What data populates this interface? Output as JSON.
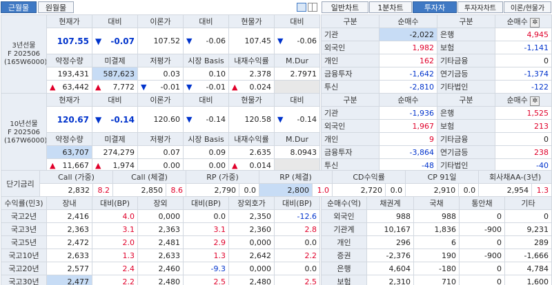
{
  "tabs_left": {
    "near": "근월물",
    "far": "원월물"
  },
  "tabs_right": [
    "일반차트",
    "1분차트",
    "투자자",
    "투자자차트",
    "이론/현물가"
  ],
  "futures": [
    {
      "label_lines": [
        "3년선물",
        "F 202506",
        "(165W6000)"
      ],
      "row1_headers": [
        "현재가",
        "대비",
        "이론가",
        "대비",
        "현물가",
        "대비"
      ],
      "price": "107.55",
      "price_change": "-0.07",
      "theory": "107.52",
      "theory_change": "-0.06",
      "spot": "107.45",
      "spot_change": "-0.06",
      "row2_headers": [
        "약정수량",
        "미결제",
        "저평가",
        "시장 Basis",
        "내재수익률",
        "M.Dur"
      ],
      "volume": "193,431",
      "open_interest": "587,623",
      "undervalue": "0.03",
      "basis": "0.10",
      "implied_yield": "2.378",
      "mdur": "2.7971",
      "volume_change": "63,442",
      "oi_change": "7,772",
      "undervalue_change": "-0.01",
      "basis_change": "-0.01",
      "yield_change": "0.024"
    },
    {
      "label_lines": [
        "10년선물",
        "F 202506",
        "(167W6000)"
      ],
      "row1_headers": [
        "현재가",
        "대비",
        "이론가",
        "대비",
        "현물가",
        "대비"
      ],
      "price": "120.67",
      "price_change": "-0.14",
      "theory": "120.60",
      "theory_change": "-0.14",
      "spot": "120.58",
      "spot_change": "-0.14",
      "row2_headers": [
        "약정수량",
        "미결제",
        "저평가",
        "시장 Basis",
        "내재수익률",
        "M.Dur"
      ],
      "volume": "63,707",
      "open_interest": "274,279",
      "undervalue": "0.07",
      "basis": "0.09",
      "implied_yield": "2.635",
      "mdur": "8.0943",
      "volume_change": "11,667",
      "oi_change": "1,974",
      "undervalue_change": "0.00",
      "basis_change": "0.00",
      "yield_change": "0.014"
    }
  ],
  "investors": [
    {
      "headers": [
        "구분",
        "순매수",
        "구분",
        "순매수"
      ],
      "rows": [
        [
          "기관",
          "-2,022",
          "은행",
          "4,945"
        ],
        [
          "외국인",
          "1,982",
          "보험",
          "-1,141"
        ],
        [
          "개인",
          "162",
          "기타금융",
          "0"
        ],
        [
          "금융투자",
          "-1,642",
          "연기금등",
          "-1,374"
        ],
        [
          "투신",
          "-2,810",
          "기타법인",
          "-122"
        ]
      ]
    },
    {
      "headers": [
        "구분",
        "순매수",
        "구분",
        "순매수"
      ],
      "rows": [
        [
          "기관",
          "-1,936",
          "은행",
          "1,525"
        ],
        [
          "외국인",
          "1,967",
          "보험",
          "213"
        ],
        [
          "개인",
          "9",
          "기타금융",
          "0"
        ],
        [
          "금융투자",
          "-3,864",
          "연기금등",
          "238"
        ],
        [
          "투신",
          "-48",
          "기타법인",
          "-40"
        ]
      ]
    }
  ],
  "short_rates": {
    "label": "단기금리",
    "headers": [
      "Call (가중)",
      "Call (체결)",
      "RP (가중)",
      "RP (체결)",
      "CD수익률",
      "CP 91일",
      "회사채AA-(3년)"
    ],
    "values": [
      [
        "2,832",
        "8.2"
      ],
      [
        "2,850",
        "8.6"
      ],
      [
        "2,790",
        "0.0"
      ],
      [
        "2,800",
        "1.0"
      ],
      [
        "2,720",
        "0.0"
      ],
      [
        "2,910",
        "0.0"
      ],
      [
        "2,954",
        "1.3"
      ]
    ]
  },
  "bonds": {
    "headers": [
      "수익률(민3)",
      "장내",
      "대비(BP)",
      "장외",
      "대비(BP)",
      "장외호가",
      "대비(BP)"
    ],
    "rows": [
      [
        "국고2년",
        "2,416",
        "4.0",
        "0,000",
        "0.0",
        "2,350",
        "-12.6"
      ],
      [
        "국고3년",
        "2,363",
        "3.1",
        "2,363",
        "3.1",
        "2,360",
        "2.8"
      ],
      [
        "국고5년",
        "2,472",
        "2.0",
        "2,481",
        "2.9",
        "0,000",
        "0.0"
      ],
      [
        "국고10년",
        "2,633",
        "1.3",
        "2,633",
        "1.3",
        "2,642",
        "2.2"
      ],
      [
        "국고20년",
        "2,577",
        "2.4",
        "2,460",
        "-9.3",
        "0,000",
        "0.0"
      ],
      [
        "국고30년",
        "2,477",
        "2.2",
        "2,480",
        "2.5",
        "2,480",
        "2.5"
      ]
    ]
  },
  "net_buy": {
    "headers": [
      "순매수(억)",
      "채권계",
      "국채",
      "통안채",
      "기타"
    ],
    "rows": [
      [
        "외국인",
        "988",
        "988",
        "0",
        "0"
      ],
      [
        "기관계",
        "10,167",
        "1,836",
        "-900",
        "9,231"
      ],
      [
        "개인",
        "296",
        "6",
        "0",
        "289"
      ],
      [
        "증권",
        "-2,376",
        "190",
        "-900",
        "-1,666"
      ],
      [
        "은행",
        "4,604",
        "-180",
        "0",
        "4,784"
      ],
      [
        "보험",
        "2,310",
        "710",
        "0",
        "1,600"
      ]
    ]
  },
  "colors": {
    "tab_active": "#3f79c4",
    "header_bg": "#e9eef5",
    "highlight": "#c7dcf5",
    "up": "#e0002a",
    "down": "#0033cc"
  }
}
